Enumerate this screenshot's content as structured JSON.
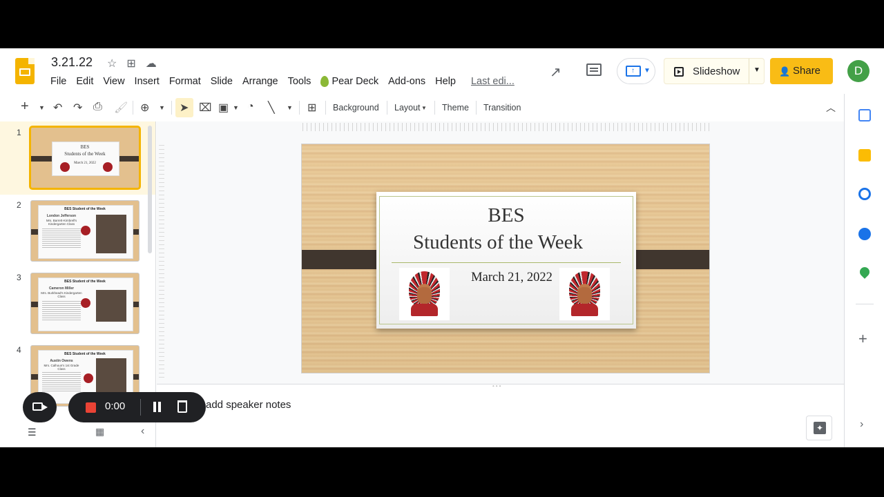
{
  "doc": {
    "title": "3.21.22"
  },
  "menu": [
    "File",
    "Edit",
    "View",
    "Insert",
    "Format",
    "Slide",
    "Arrange",
    "Tools",
    "Pear Deck",
    "Add-ons",
    "Help"
  ],
  "last_edit": "Last edi...",
  "header": {
    "slideshow_label": "Slideshow",
    "share_label": "Share",
    "avatar_initial": "D"
  },
  "toolbar": {
    "background": "Background",
    "layout": "Layout",
    "theme": "Theme",
    "transition": "Transition"
  },
  "slides": [
    {
      "num": "1",
      "title1": "BES",
      "title2": "Students of the Week",
      "date": "March 21, 2022"
    },
    {
      "num": "2",
      "heading": "BES Student of the Week",
      "name": "London Jefferson",
      "class": "Mrs. Barrett-Kimbrell's Kindergarten Class"
    },
    {
      "num": "3",
      "heading": "BES Student of the Week",
      "name": "Cameron Miller",
      "class": "Mrs. Burkhead's Kindergarten Class"
    },
    {
      "num": "4",
      "heading": "BES Student of the Week",
      "name": "Austin Owens",
      "class": "Mrs. Calhoun's 1st Grade Class"
    }
  ],
  "current_slide": {
    "title_line1": "BES",
    "title_line2": "Students of the Week",
    "date": "March 21, 2022"
  },
  "notes": {
    "placeholder": "add speaker notes"
  },
  "recorder": {
    "time": "0:00"
  },
  "colors": {
    "accent": "#f4b400",
    "share": "#f9bc15",
    "record": "#ea4335",
    "avatar": "#43a047"
  }
}
